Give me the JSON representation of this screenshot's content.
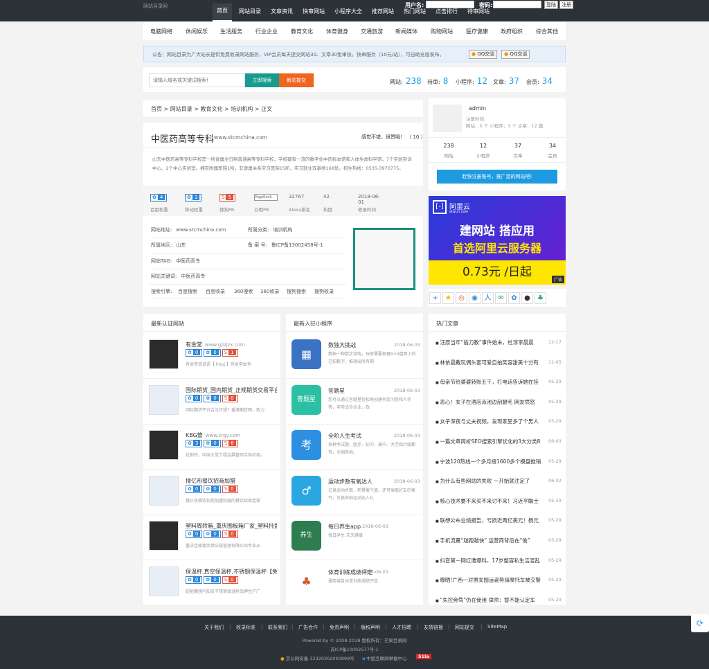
{
  "logo_alt": "网站目录网",
  "nav": [
    "首页",
    "网站目录",
    "文章资讯",
    "快审网站",
    "小程序大全",
    "推荐网站",
    "热门网站",
    "点击排行",
    "待审网站"
  ],
  "login": {
    "user_label": "用户名:",
    "pass_label": "密码:",
    "login_btn": "登陆",
    "reg_btn": "注册"
  },
  "categories": [
    "电脑网络",
    "休闲娱乐",
    "生活服务",
    "行业企业",
    "教育文化",
    "体育健身",
    "交通旅游",
    "新闻媒体",
    "购物网站",
    "医疗健康",
    "政府组织",
    "综合其他"
  ],
  "notice": "公告：网站目录为广大站长提供免费收录网站服务，VIP会员每天提交网站30、文章30免审核，快审服务（10元/站），可自助充值发布。",
  "qq_btn": "QQ交谈",
  "search": {
    "placeholder": "请输入域名或关键词搜索!",
    "search_btn": "立即搜索",
    "submit_btn": "新站提交"
  },
  "stats": [
    {
      "label": "网站:",
      "value": "238"
    },
    {
      "label": "待审:",
      "value": "8"
    },
    {
      "label": "小程序:",
      "value": "12"
    },
    {
      "label": "文章:",
      "value": "37"
    },
    {
      "label": "会员:",
      "value": "34"
    }
  ],
  "breadcrumb": "首页 > 网站目录 > 教育文化 > 培训机构 > 正文",
  "site": {
    "name": "中医药高等专科",
    "url": "www.stcmchina.com",
    "vote": "感觉不错，很赞哦！ （  10  ）",
    "desc": "山东中医药高等专科学校是一所省属全日制普通高等专科学校，学校建有一流的数字化中药标本馆和人体生命科学馆，7个实验实训中心、2个中心实验室。拥有附属医院1所，非隶属关系实习医院15所，实习就业双基地168处。招生热线：0535-3970775。",
    "metrics": [
      {
        "v": "4",
        "l": "百度权重"
      },
      {
        "v": "1",
        "l": "移动权重"
      },
      {
        "v": "5",
        "l": "搜狗PR"
      },
      {
        "v": "PageRank",
        "l": "谷歌PR"
      },
      {
        "v": "32767",
        "l": "Alexa排名"
      },
      {
        "v": "42",
        "l": "热度"
      },
      {
        "v": "2018-06-01",
        "l": "收录时间"
      }
    ],
    "info": [
      {
        "k": "网站地址:",
        "v": "www.stcmchina.com"
      },
      {
        "k": "所属分类:",
        "v": "培训机构"
      },
      {
        "k": "所属地区:",
        "v": "山东"
      },
      {
        "k": "备 案 号:",
        "v": "鲁ICP备13002458号-1"
      },
      {
        "k": "网站TAG:",
        "v": "中医药高专"
      },
      {
        "k": "网站关键词:",
        "v": "中医药高专"
      }
    ],
    "engines_label": "搜索引擎:",
    "engines": [
      "百度搜索",
      "百度收录",
      "360搜索",
      "360收录",
      "搜狗搜索",
      "搜狗收录"
    ]
  },
  "user": {
    "name": "admin",
    "reg": "注册时间:",
    "counts": "网站：0 个   小程序：3 个   文章：12 篇",
    "stats": [
      {
        "v": "238",
        "l": "网站"
      },
      {
        "v": "12",
        "l": "小程序"
      },
      {
        "v": "37",
        "l": "文章"
      },
      {
        "v": "34",
        "l": "会员"
      }
    ],
    "cta": "赶快注册账号，推广您的网站吧!"
  },
  "ad": {
    "brand": "阿里云",
    "brand_en": "aliyun.com",
    "line1": "建网站 搭应用",
    "line2": "首选阿里云服务器",
    "price": "0.73元 /日起",
    "tag": "广告"
  },
  "latest_sites": {
    "title": "最新认证网站",
    "items": [
      {
        "name": "有金堂",
        "url": "www.gjlzjzx.com",
        "b": [
          "0",
          "0",
          "1"
        ],
        "desc": "有金堂道谚语【 hhpj 】有金堂由有"
      },
      {
        "name": "国际期货_国内期货_正规期货交易平台",
        "url": "",
        "b": [
          "0",
          "0",
          "0"
        ],
        "desc": "国际期货平台合法正规？香港期货网，致力"
      },
      {
        "name": "KBG管",
        "url": "www.crgy.com",
        "b": [
          "3",
          "0",
          "6"
        ],
        "desc": "优耐特，中国大型工程金属管综合供应商。"
      },
      {
        "name": "搜亿热餐饮招商加盟",
        "url": "",
        "b": [
          "0",
          "0",
          "0"
        ],
        "desc": "搜亿热餐饮招商加盟权威的餐饮招商连锁"
      },
      {
        "name": "塑料周转箱_重庆围板箱厂家_塑料托盘",
        "url": "",
        "b": [
          "0",
          "0",
          "0"
        ],
        "desc": "重庆佳峻德尚供应链管理有限公司专业从"
      },
      {
        "name": "保温杯,真空保温杯,不锈钢保温杯【免费",
        "url": "",
        "b": [
          "0",
          "0",
          "0"
        ],
        "desc": "超能集团内知名不锈钢保温杯品牌生产厂"
      }
    ]
  },
  "mini": {
    "title": "最新入驻小程序",
    "items": [
      {
        "name": "数独大挑战",
        "date": "2018-06-03",
        "desc": "数独一种数字游戏，玩家需要根据9×9盘面上的已知数字，推理出所有剩"
      },
      {
        "name": "答题星",
        "date": "2018-06-03",
        "desc": "您可以通过答题星轻松地创建有奖问卷和人作答，非常适合企业、政"
      },
      {
        "name": "全阶人生考试",
        "date": "2018-06-03",
        "desc": "各种考试题，医疗、初中、高中、大学四六级都有，全国各地。"
      },
      {
        "name": "运动步数有氧达人",
        "date": "2018-06-03",
        "desc": "记录运动步数，积累氧气值，还可偷取好友的氧气，兑换各种运动达人礼"
      },
      {
        "name": "每日养生app",
        "date": "2018-06-03",
        "desc": "每日养生,天天健康"
      },
      {
        "name": "体育训练成绩评定",
        "date": "2018-06-03",
        "desc": "通用课目体育训练成绩评定"
      }
    ]
  },
  "hot": {
    "title": "热门文章",
    "items": [
      {
        "t": "汪原当年“插刀教”事件始末，杜淳李晨晨",
        "d": "12-17"
      },
      {
        "t": "林依晨戴玩偶头套可爱自拍笑容甜美十分有",
        "d": "11-05"
      },
      {
        "t": "母亲节给婆婆转账五千，打电话告诉她在挂",
        "d": "05-29"
      },
      {
        "t": "恶心！女子在酒店泳池边刮腿毛 网友愤怒",
        "d": "05-29"
      },
      {
        "t": "女子深夜与丈夫视频，发现家里多了个男人",
        "d": "05-29"
      },
      {
        "t": "一篇文章简析SEO搜索引擎优化的3大分类8",
        "d": "06-03"
      },
      {
        "t": "宁波120热线一个多月接1600多个模盘推销",
        "d": "05-29"
      },
      {
        "t": "为什么有些网站的失败 一开始就注定了",
        "d": "06-02"
      },
      {
        "t": "核心技术要不来买不来讨不来！习近平瞩士",
        "d": "05-29"
      },
      {
        "t": "联想公布业绩报告，亏损近两亿美元！杨元",
        "d": "05-29"
      },
      {
        "t": "手机流量“越跑越快” 运营商背后在“偷”",
        "d": "05-29"
      },
      {
        "t": "抖音第一网红遭爆料，17岁整容私生活混乱",
        "d": "05-29"
      },
      {
        "t": "曝晒!广西一对男女园运姿势骑摩托车被交警",
        "d": "05-29"
      },
      {
        "t": "“失控旁骛”仍在使用 律师：暂不能认定车",
        "d": "05-29"
      }
    ]
  },
  "footer": {
    "links": [
      "关于我们",
      "收录标准",
      "联系我们",
      "广告合作",
      "免责声明",
      "版权声明",
      "人才招聘",
      "友情链接",
      "网站提交",
      "SiteMap"
    ],
    "copyright": "Powered by © 2008-2018  版权所有：芒果目录网",
    "icp": "苏ICP备10002577号-1",
    "police": "京公网安备 32320302000899号",
    "report": "中国互联网举报中心",
    "la": "51la"
  },
  "colors": {
    "header": "#2d3238",
    "accent": "#1e9be0",
    "search_btn": "#169b8e",
    "submit_btn": "#f0641e",
    "ad_bg": "#4b1fd6",
    "ad_price_bg": "#ffe600"
  }
}
